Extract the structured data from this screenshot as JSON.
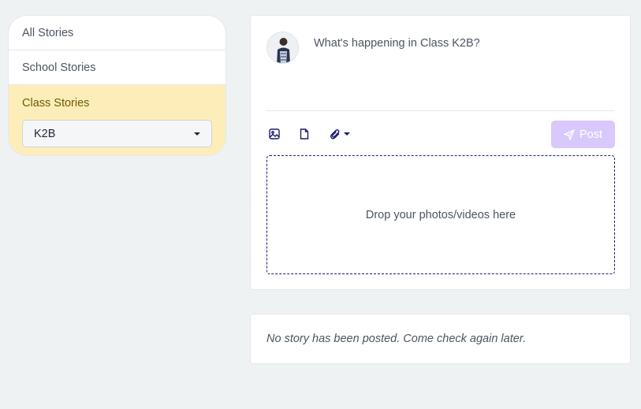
{
  "sidebar": {
    "items": [
      {
        "label": "All Stories"
      },
      {
        "label": "School Stories"
      },
      {
        "label": "Class Stories"
      }
    ],
    "class_select": {
      "value": "K2B"
    }
  },
  "composer": {
    "placeholder": "What's happening in Class K2B?",
    "tools": [
      "image-icon",
      "file-icon",
      "paperclip-icon"
    ],
    "post_label": "Post",
    "dropzone_text": "Drop your photos/videos here"
  },
  "feed": {
    "empty_message": "No story has been posted. Come check again later."
  },
  "colors": {
    "page_bg": "#eff2f3",
    "active_bg": "#fdedb9",
    "active_text": "#715a00",
    "post_button": "#d9c8fb",
    "icon": "#1c1a6e"
  }
}
